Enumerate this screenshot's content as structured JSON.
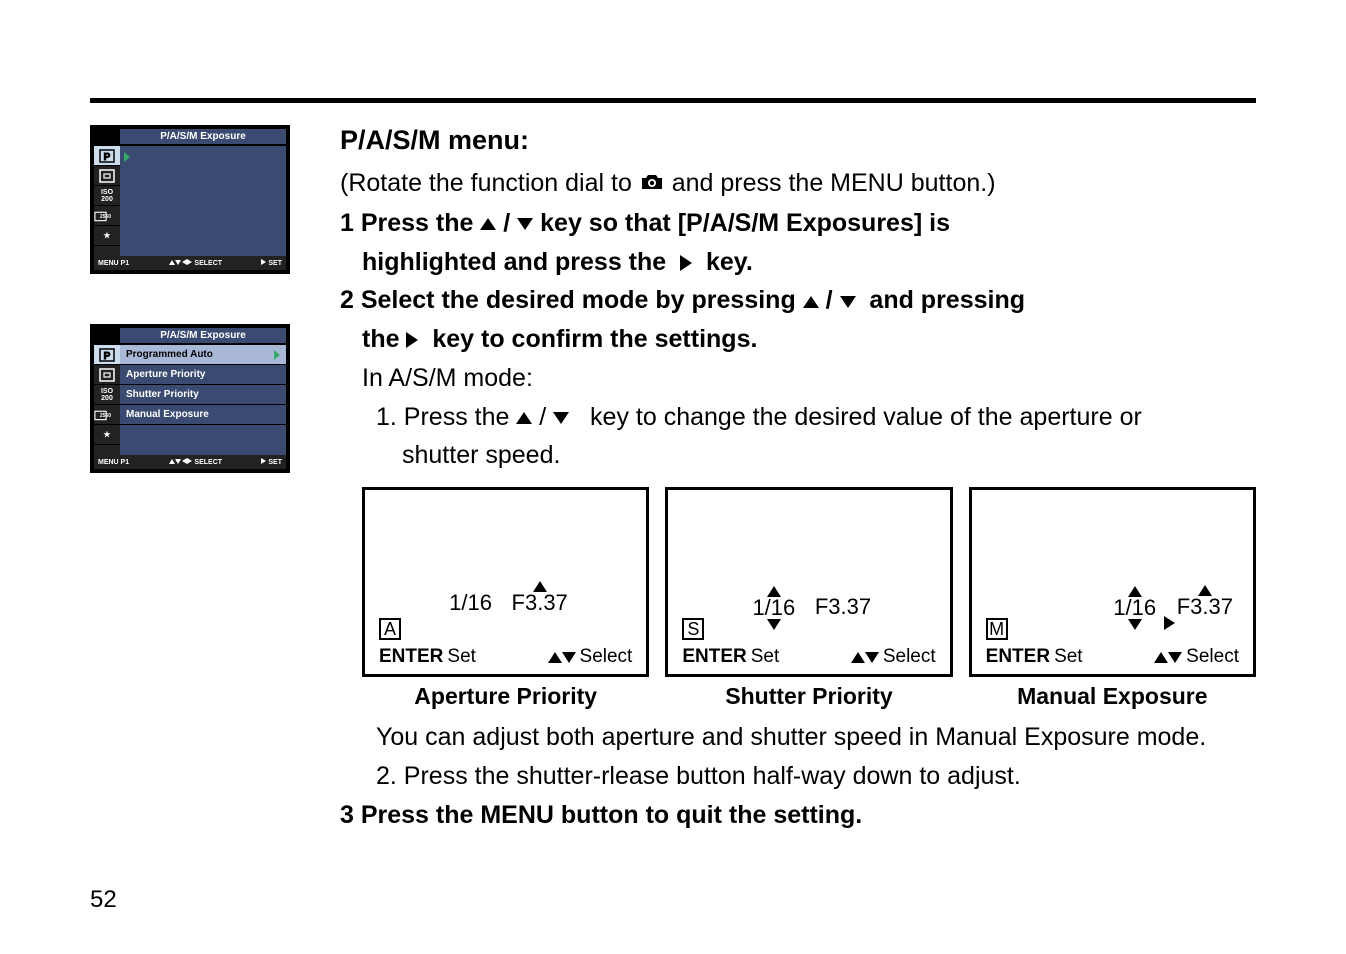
{
  "page_number": "52",
  "menu_screenshot": {
    "header": "P/A/S/M Exposure",
    "icons": [
      "P",
      "square",
      "ISO200",
      "2560",
      "stars"
    ],
    "footer": {
      "menu": "MENU P1",
      "select": "SELECT",
      "set": "SET"
    }
  },
  "menu_expanded": {
    "header": "P/A/S/M Exposure",
    "items": [
      {
        "label": "Programmed Auto",
        "selected": true
      },
      {
        "label": "Aperture Priority",
        "selected": false
      },
      {
        "label": "Shutter Priority",
        "selected": false
      },
      {
        "label": "Manual Exposure",
        "selected": false
      }
    ],
    "footer": {
      "menu": "MENU P1",
      "select": "SELECT",
      "set": "SET"
    }
  },
  "content": {
    "title": "P/A/S/M menu:",
    "rotate_pre": "(Rotate the function dial to ",
    "rotate_post": " and press the MENU button.)",
    "step1_a": "1 Press the ",
    "step1_b": " / ",
    "step1_c": " key so that [P/A/S/M Exposures] is",
    "step1_d": "highlighted and press the ",
    "step1_e": " key.",
    "step2_a": "2 Select the desired mode by pressing ",
    "step2_b": " / ",
    "step2_c": " and pressing",
    "step2_d": "the ",
    "step2_e": " key to confirm the settings.",
    "asm_intro": "In A/S/M mode:",
    "asm_1a": "1. Press the ",
    "asm_1b": " / ",
    "asm_1c": " key to change the desired value of the aperture or",
    "asm_1d": "shutter speed.",
    "previews": [
      {
        "mode": "A",
        "shutter": "1/16",
        "aperture": "F3.37",
        "caption": "Aperture Priority",
        "up_on": "aperture",
        "right_between": false
      },
      {
        "mode": "S",
        "shutter": "1/16",
        "aperture": "F3.37",
        "caption": "Shutter Priority",
        "up_on": "shutter",
        "down_on": "shutter"
      },
      {
        "mode": "M",
        "shutter": "1/16",
        "aperture": "F3.37",
        "caption": "Manual Exposure",
        "up_on": "both",
        "down_on": "shutter",
        "right_between": true
      }
    ],
    "preview_footer": {
      "enter": "ENTER",
      "set": "Set",
      "select": "Select"
    },
    "manual_note": "You can adjust both aperture and shutter speed in Manual Exposure mode.",
    "asm_2": "2. Press the shutter-rlease button half-way down to adjust.",
    "step3": "3 Press the MENU button to quit the setting."
  }
}
